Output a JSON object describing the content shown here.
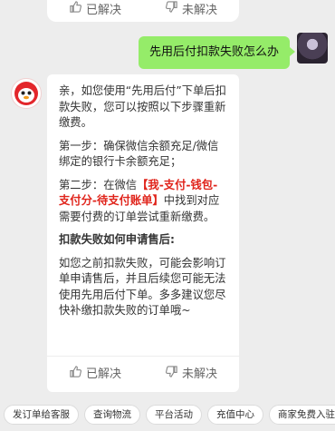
{
  "top_feedback": {
    "helpful": "已解决",
    "not_helpful": "未解决"
  },
  "user_message": "先用后付扣款失败怎么办",
  "bot_message": {
    "intro": "亲，如您使用“先用后付”下单后扣款失败，您可以按照以下步骤重新缴费。",
    "step1": "第一步：确保微信余额充足/微信绑定的银行卡余额充足；",
    "step2_prefix": "第二步：在微信",
    "step2_path": "【我-支付-钱包-支付分-待支付账单】",
    "step2_suffix": "中找到对应需要付费的订单尝试重新缴费。",
    "question": "扣款失败如何申请售后:",
    "answer": "如您之前扣款失败，可能会影响订单申请售后，并且后续您可能无法使用先用后付下单。多多建议您尽快补缴扣款失败的订单哦~"
  },
  "bot_feedback": {
    "helpful": "已解决",
    "not_helpful": "未解决"
  },
  "quick_actions": [
    "发订单给客服",
    "查询物流",
    "平台活动",
    "充值中心",
    "商家免费入驻"
  ],
  "colors": {
    "user_bubble": "#95ec69",
    "highlight": "#e0241b",
    "background": "#ededed"
  }
}
